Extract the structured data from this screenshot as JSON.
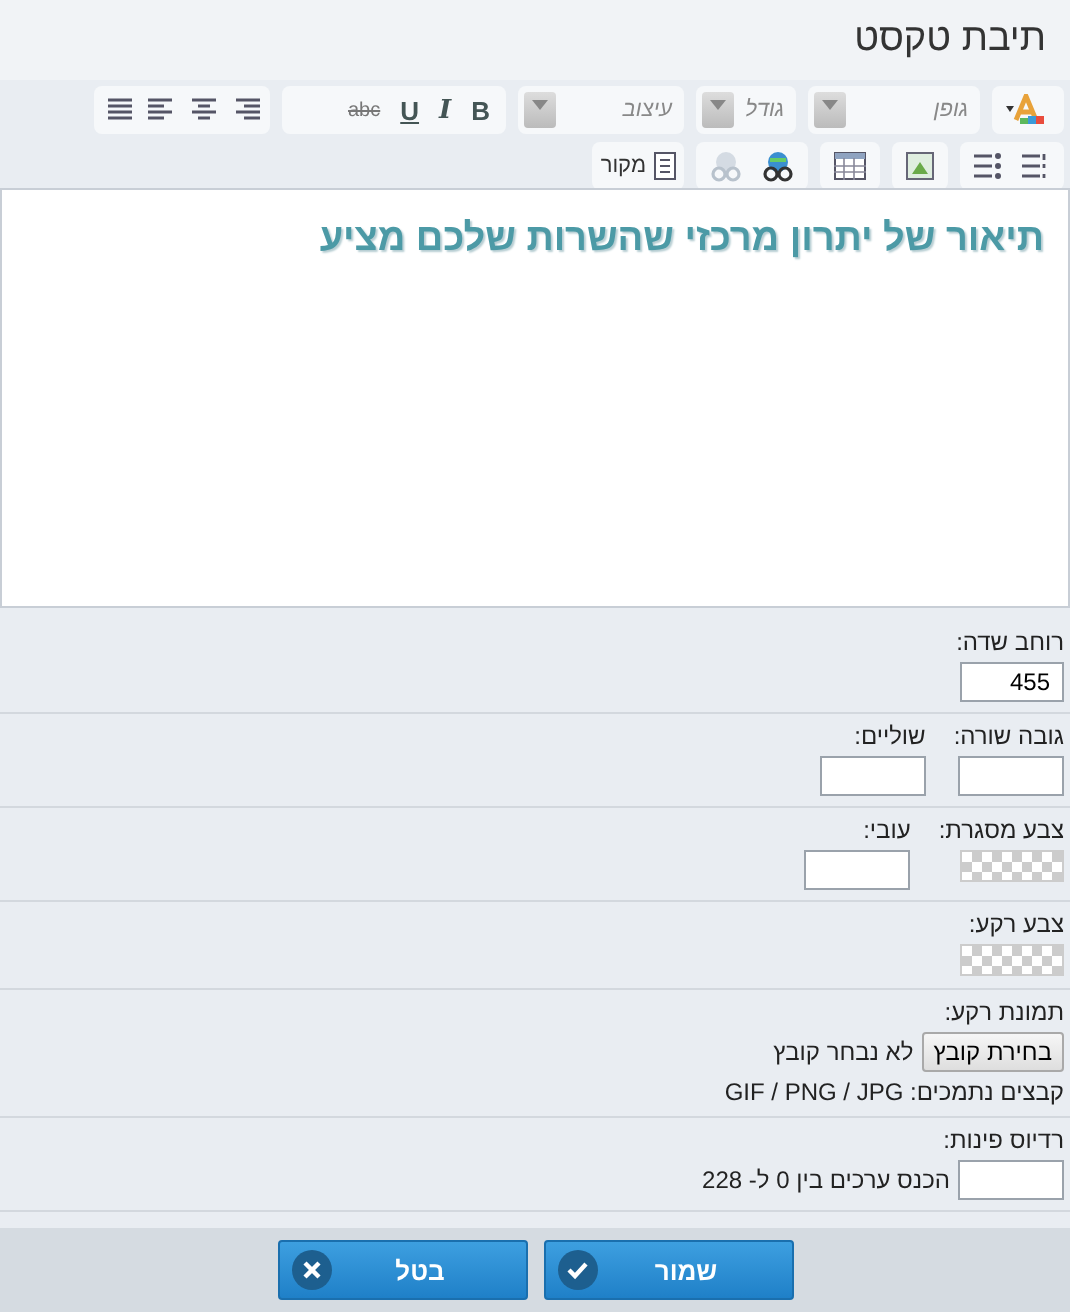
{
  "window": {
    "title": "תיבת טקסט"
  },
  "toolbar": {
    "selects": [
      {
        "placeholder": "גופן"
      },
      {
        "placeholder": "גודל"
      },
      {
        "placeholder": "עיצוב"
      }
    ],
    "format_buttons": [
      {
        "kind": "bold",
        "label": "B"
      },
      {
        "kind": "italic",
        "label": "I"
      },
      {
        "kind": "underline",
        "label": "U"
      },
      {
        "kind": "strike",
        "label": "abc"
      }
    ],
    "source_label": "מקור"
  },
  "editor": {
    "heading": "תיאור של יתרון מרכזי שהשרות שלכם מציע"
  },
  "sections": [
    {
      "columns": [
        {
          "label": "רוחב שדה:",
          "control": {
            "kind": "wide-input",
            "value": "455"
          }
        }
      ]
    },
    {
      "columns": [
        {
          "label": "גובה שורה:",
          "control": {
            "kind": "input"
          }
        },
        {
          "label": "שוליים:",
          "control": {
            "kind": "input"
          }
        }
      ]
    },
    {
      "columns": [
        {
          "label": "צבע מסגרת:",
          "control": {
            "kind": "swatch"
          }
        },
        {
          "label": "עובי:",
          "control": {
            "kind": "input"
          }
        }
      ]
    },
    {
      "columns": [
        {
          "label": "צבע רקע:",
          "control": {
            "kind": "swatch"
          }
        }
      ]
    },
    {
      "columns": [
        {
          "label": "תמונת רקע:",
          "control": {
            "kind": "file",
            "button": "בחירת קובץ",
            "status": "לא נבחר קובץ",
            "note": "קבצים נתמכים: GIF / PNG / JPG"
          }
        }
      ]
    },
    {
      "columns": [
        {
          "label": "רדיוס פינות:",
          "control": {
            "kind": "input-hint",
            "hint": "הכנס ערכים בין 0 ל- 228"
          }
        }
      ]
    }
  ],
  "buttons": [
    {
      "kind": "save",
      "label": "שמור"
    },
    {
      "kind": "cancel",
      "label": "בטל"
    }
  ]
}
